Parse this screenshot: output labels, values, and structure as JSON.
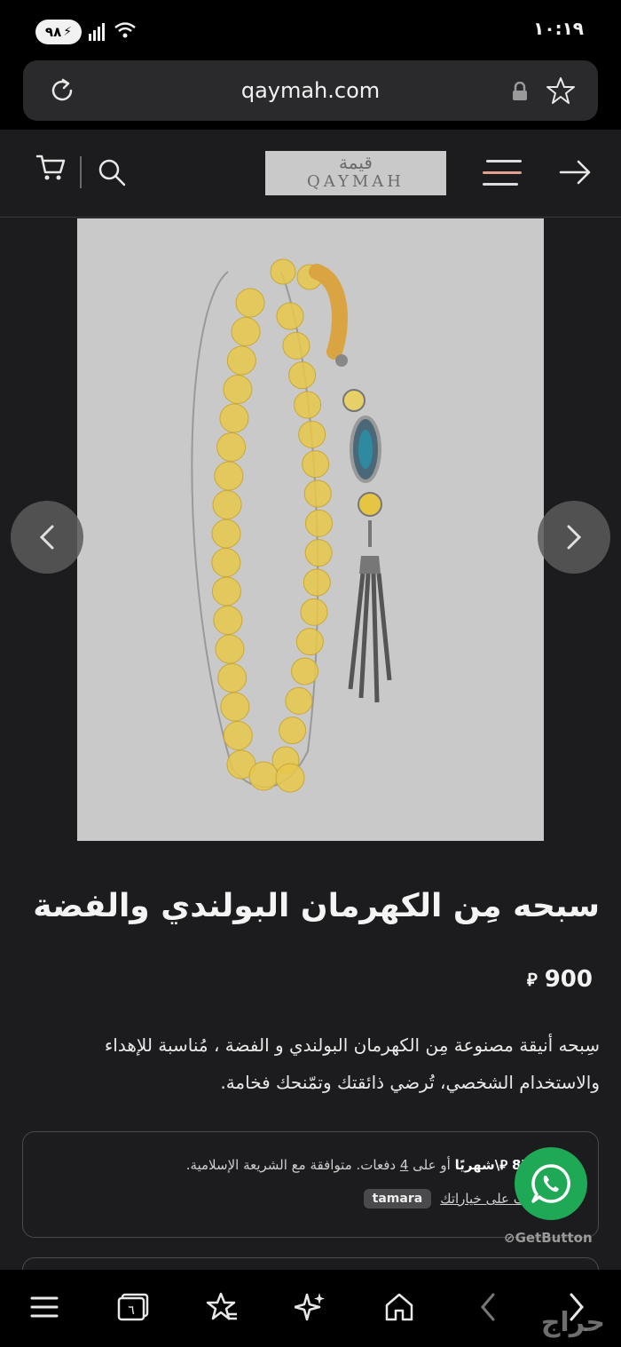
{
  "status_bar": {
    "battery_level": "٩٨",
    "time": "١٠:١٩",
    "network": "5"
  },
  "browser": {
    "url": "qaymah.com"
  },
  "site_header": {
    "logo_arabic": "قيمة",
    "logo_english": "QAYMAH"
  },
  "product": {
    "title": "سبحه مِن الكهرمان البولندي والفضة",
    "price": "900",
    "currency_symbol": "⃁",
    "description": "سِبحه أنيقة مصنوعة مِن الكهرمان البولندي  و الفضة ، مُناسبة للإهداء والاستخدام الشخصي، تُرضي ذائقتك وتمّنحك فخامة."
  },
  "installments": {
    "monthly_amount": "87.7",
    "monthly_label": "⃁\\شهريًا",
    "text_or": "أو على",
    "count": "4",
    "text_rest": "دفعات. متوافقة مع الشريعة الإسلامية.",
    "options_link": "تعرّف على خياراتك",
    "provider_badge": "tamara"
  },
  "whatsapp": {
    "powered_by": "GetButton"
  },
  "watermark": "حراج",
  "colors": {
    "whatsapp_green": "#1fa855",
    "background": "#1c1c1e",
    "image_background": "#c9c9c9",
    "amber": "#e8c84a"
  }
}
